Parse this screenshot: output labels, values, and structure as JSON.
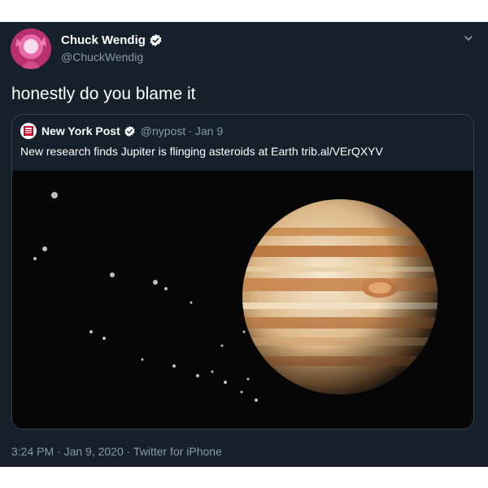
{
  "tweet": {
    "author": {
      "display_name": "Chuck Wendig",
      "handle": "@ChuckWendig",
      "avatar_icon": "profile-avatar",
      "verified": true
    },
    "text": "honestly do you blame it",
    "quoted": {
      "display_name": "New York Post",
      "handle": "@nypost",
      "date": "Jan 9",
      "text": "New research finds Jupiter is flinging asteroids at Earth trib.al/VErQXYV",
      "verified": true
    },
    "footer": "3:24 PM · Jan 9, 2020 · Twitter for iPhone"
  },
  "colors": {
    "background": "#15202b",
    "secondary_text": "#8899a6",
    "verified": "#ffffff",
    "border": "#38444d"
  }
}
